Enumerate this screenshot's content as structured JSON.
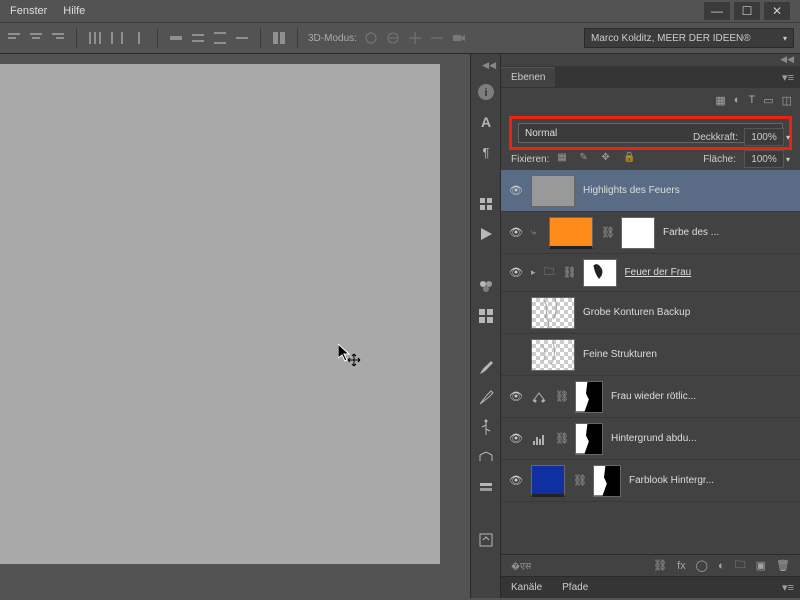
{
  "menu": {
    "fenster": "Fenster",
    "hilfe": "Hilfe"
  },
  "optbar": {
    "mode3d": "3D-Modus:"
  },
  "workspace": "Marco Kolditz, MEER DER IDEEN®",
  "panel": {
    "tab_ebenen": "Ebenen",
    "blend_mode": "Normal",
    "deckkraft_label": "Deckkraft:",
    "deckkraft_value": "100%",
    "fixieren_label": "Fixieren:",
    "flaeche_label": "Fläche:",
    "flaeche_value": "100%"
  },
  "layers": [
    {
      "name": "Highlights des Feuers",
      "visible": true,
      "selected": true,
      "thumb": "gray"
    },
    {
      "name": "Farbe des ...",
      "visible": true,
      "thumb": "orange",
      "linked": true,
      "mask": "white"
    },
    {
      "name": "Feuer der Frau",
      "visible": true,
      "group": true,
      "thumb": "fire",
      "underline": true
    },
    {
      "name": "Grobe Konturen Backup",
      "visible": false,
      "thumb": "trans-smoke"
    },
    {
      "name": "Feine Strukturen",
      "visible": false,
      "thumb": "trans-smoke"
    },
    {
      "name": "Frau wieder rötlic...",
      "visible": true,
      "adj": "balance",
      "mask": true
    },
    {
      "name": "Hintergrund abdu...",
      "visible": true,
      "adj": "levels",
      "mask": true
    },
    {
      "name": "Farblook Hintergr...",
      "visible": true,
      "thumb": "blue",
      "linked": true,
      "mask": true
    }
  ],
  "bottom_tabs": {
    "kanaele": "Kanäle",
    "pfade": "Pfade"
  }
}
